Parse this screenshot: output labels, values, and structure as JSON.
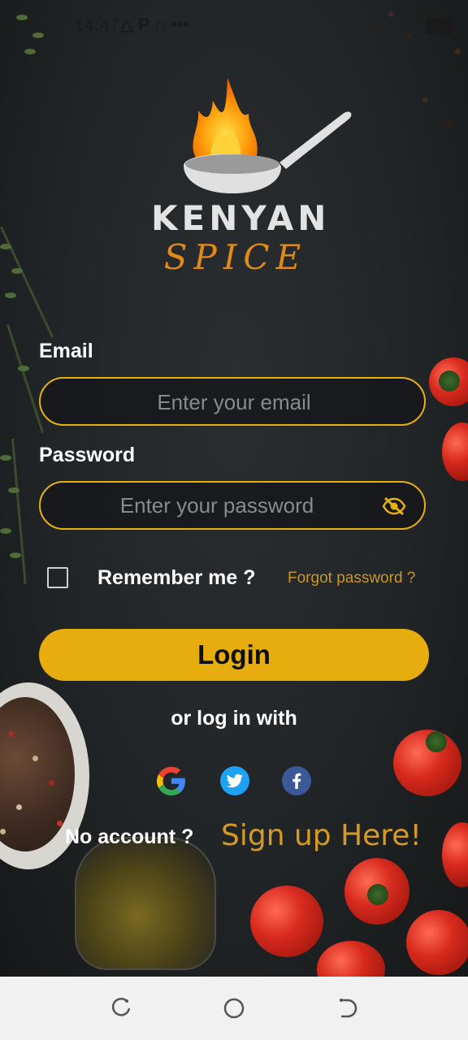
{
  "status_bar": {
    "time": "14:47",
    "icons": "△ P ∩ •••"
  },
  "brand": {
    "line1": "KENYAN",
    "line2": "SPICE"
  },
  "form": {
    "email_label": "Email",
    "email_placeholder": "Enter your email",
    "password_label": "Password",
    "password_placeholder": "Enter your password",
    "remember_label": "Remember me ?",
    "forgot_label": "Forgot password ?",
    "login_label": "Login"
  },
  "social": {
    "or_label": "or log in with",
    "providers": [
      "google",
      "twitter",
      "facebook"
    ]
  },
  "signup": {
    "prompt": "No account ?",
    "link": "Sign up Here!"
  },
  "colors": {
    "accent": "#e7ad0f",
    "signup": "#d49a25",
    "forgot": "#c8962a"
  },
  "icons": [
    "logo-flame-pan-icon",
    "eye-slash-icon",
    "google-icon",
    "twitter-icon",
    "facebook-icon",
    "recent-apps-icon",
    "home-icon",
    "back-icon"
  ]
}
